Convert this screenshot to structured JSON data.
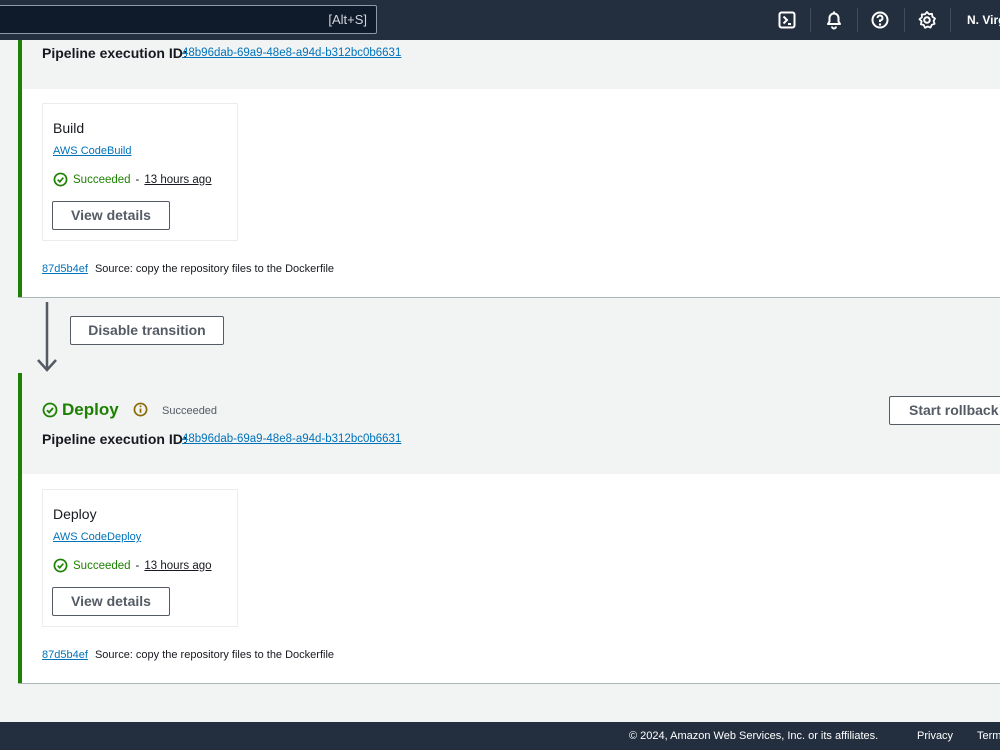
{
  "topnav": {
    "search_hint": "[Alt+S]",
    "region": "N. Virginia",
    "icons": [
      "cloudshell-icon",
      "bell-icon",
      "help-icon",
      "settings-icon"
    ]
  },
  "colors": {
    "nav_bg": "#232f3e",
    "success": "#1d8102",
    "link": "#0073bb",
    "info": "#8a6b05"
  },
  "build_stage": {
    "exec_label": "Pipeline execution ID:",
    "exec_id": "48b96dab-69a9-48e8-a94d-b312bc0b6631",
    "action": {
      "name": "Build",
      "provider": "AWS CodeBuild",
      "status": "Succeeded",
      "separator": "-",
      "time": "13 hours ago",
      "button": "View details"
    },
    "commit_id": "87d5b4ef",
    "commit_msg": "Source: copy the repository files to the Dockerfile"
  },
  "transition": {
    "button": "Disable transition"
  },
  "deploy_stage": {
    "name": "Deploy",
    "state": "Succeeded",
    "rollback_button": "Start rollback",
    "exec_label": "Pipeline execution ID:",
    "exec_id": "48b96dab-69a9-48e8-a94d-b312bc0b6631",
    "action": {
      "name": "Deploy",
      "provider": "AWS CodeDeploy",
      "status": "Succeeded",
      "separator": "-",
      "time": "13 hours ago",
      "button": "View details"
    },
    "commit_id": "87d5b4ef",
    "commit_msg": "Source: copy the repository files to the Dockerfile"
  },
  "footer": {
    "copyright": "© 2024, Amazon Web Services, Inc. or its affiliates.",
    "privacy": "Privacy",
    "terms": "Terms"
  }
}
